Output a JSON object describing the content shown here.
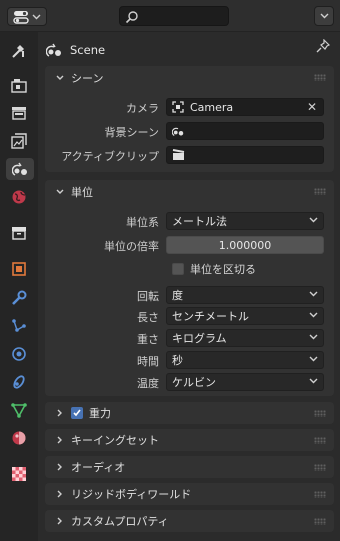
{
  "context": {
    "label": "Scene"
  },
  "panels": {
    "scene": {
      "title": "シーン",
      "camera_label": "カメラ",
      "camera_value": "Camera",
      "background_label": "背景シーン",
      "clip_label": "アクティブクリップ"
    },
    "units": {
      "title": "単位",
      "system_label": "単位系",
      "system_value": "メートル法",
      "scale_label": "単位の倍率",
      "scale_value": "1.000000",
      "separate_label": "単位を区切る",
      "rotation_label": "回転",
      "rotation_value": "度",
      "length_label": "長さ",
      "length_value": "センチメートル",
      "mass_label": "重さ",
      "mass_value": "キログラム",
      "time_label": "時間",
      "time_value": "秒",
      "temp_label": "温度",
      "temp_value": "ケルビン"
    },
    "gravity": {
      "title": "重力",
      "enabled": true
    },
    "keying": {
      "title": "キーイングセット"
    },
    "audio": {
      "title": "オーディオ"
    },
    "rigidbody": {
      "title": "リジッドボディワールド"
    },
    "custom": {
      "title": "カスタムプロパティ"
    }
  },
  "tabs": [
    "tool-icon",
    "render-icon",
    "output-icon",
    "view-layer-icon",
    "scene-icon",
    "world-icon",
    "collection-icon",
    "object-icon",
    "modifier-icon",
    "particles-icon",
    "physics-icon",
    "constraints-icon",
    "data-icon",
    "material-icon",
    "texture-icon"
  ],
  "colors": {
    "accent": "#4772b3",
    "panel": "#323232",
    "background": "#2b2b2b"
  }
}
